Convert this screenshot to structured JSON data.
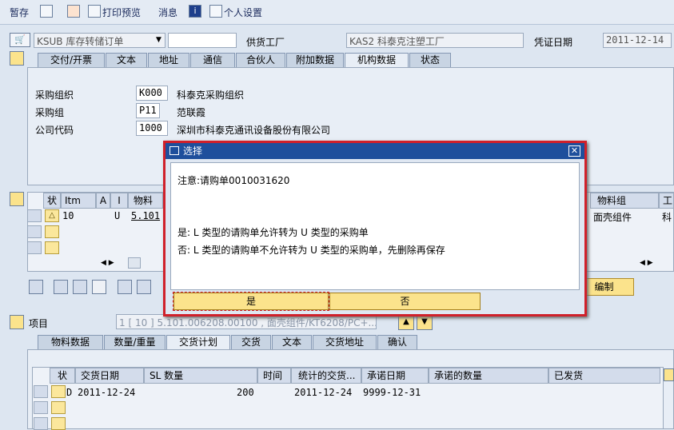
{
  "toolbar": {
    "hold": "暂存",
    "print_preview": "打印预览",
    "messages": "消息",
    "personal_settings": "个人设置"
  },
  "header": {
    "doc_type": "KSUB 库存转储订单",
    "vendor_plant_label": "供货工厂",
    "vendor_plant_value": "KAS2 科泰克注塑工厂",
    "doc_date_label": "凭证日期",
    "doc_date_value": "2011-12-14"
  },
  "header_tabs": [
    "交付/开票",
    "文本",
    "地址",
    "通信",
    "合伙人",
    "附加数据",
    "机构数据",
    "状态"
  ],
  "org_data": {
    "purch_org_label": "采购组织",
    "purch_org_code": "K000",
    "purch_org_name": "科泰克采购组织",
    "purch_group_label": "采购组",
    "purch_group_code": "P11",
    "purch_group_name": "范联霞",
    "company_label": "公司代码",
    "company_code": "1000",
    "company_name": "深圳市科泰克通讯设备股份有限公司"
  },
  "items_table": {
    "headers": [
      "状",
      "Itm",
      "A",
      "I",
      "物料",
      "物料组"
    ],
    "extra_header": "工",
    "row": {
      "itm": "10",
      "i": "U",
      "material": "5.101",
      "material_group": "面壳组件",
      "extra": "科"
    },
    "button_label": "编制"
  },
  "item_detail": {
    "label": "项目",
    "selector": "1 [ 10 ] 5.101.006208.00100 , 面壳组件/KT6208/PC+..."
  },
  "item_tabs": [
    "物料数据",
    "数量/重量",
    "交货计划",
    "交货",
    "文本",
    "交货地址",
    "确认"
  ],
  "schedule_table": {
    "headers": [
      "状",
      "交货日期",
      "SL 数量",
      "时间",
      "统计的交货...",
      "承诺日期",
      "承诺的数量",
      "已发货"
    ],
    "row": {
      "flag": "D",
      "date": "2011-12-24",
      "qty": "200",
      "stat_date": "2011-12-24",
      "commit_date": "9999-12-31"
    }
  },
  "dialog": {
    "title": "选择",
    "note": "注意:请购单0010031620",
    "line_yes": "是: L 类型的请购单允许转为 U 类型的采购单",
    "line_no": "否: L 类型的请购单不允许转为 U 类型的采购单，先删除再保存",
    "btn_yes": "是",
    "btn_no": "否"
  }
}
